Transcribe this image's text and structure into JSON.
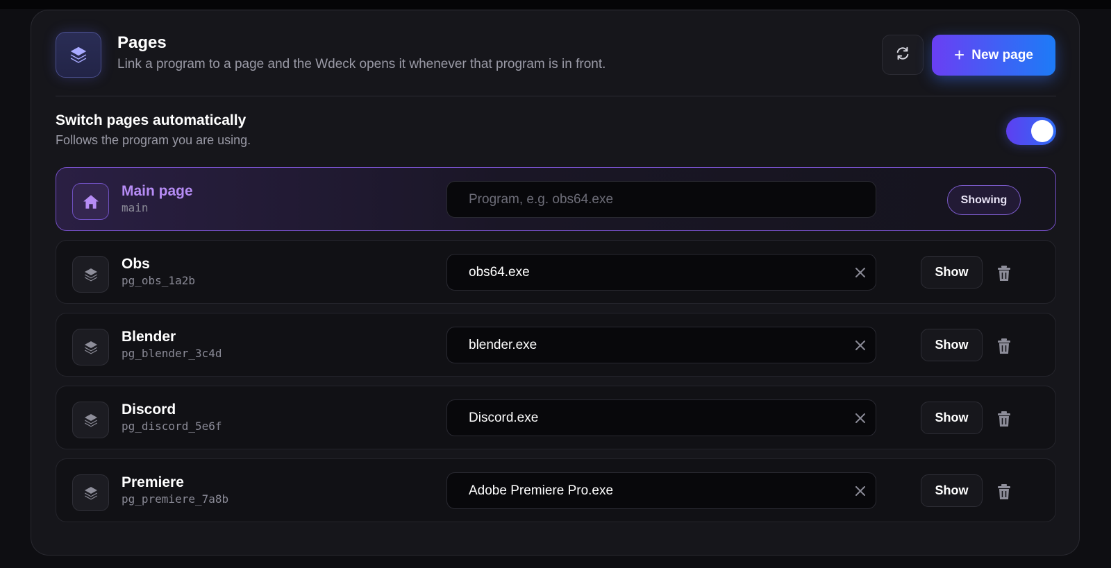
{
  "header": {
    "title": "Pages",
    "subtitle": "Link a program to a page and the Wdeck opens it whenever that program is in front.",
    "icon": "layers-icon",
    "refresh_icon": "refresh-icon",
    "new_button_label": "New page",
    "new_button_icon": "plus-icon"
  },
  "auto_switch": {
    "title": "Switch pages automatically",
    "subtitle": "Follows the program you are using.",
    "enabled": true
  },
  "colors": {
    "accent_purple": "#6a3ff3",
    "accent_blue": "#1d7bf7",
    "active_text": "#b68cf5"
  },
  "pages": [
    {
      "name": "Main page",
      "id": "main",
      "program": "",
      "placeholder": "Program, e.g. obs64.exe",
      "active": true,
      "status": "Showing",
      "icon": "home-icon"
    },
    {
      "name": "Obs",
      "id": "pg_obs_1a2b",
      "program": "obs64.exe",
      "placeholder": "Program, e.g. obs64.exe",
      "active": false,
      "action": "Show",
      "icon": "layers-icon"
    },
    {
      "name": "Blender",
      "id": "pg_blender_3c4d",
      "program": "blender.exe",
      "placeholder": "Program, e.g. obs64.exe",
      "active": false,
      "action": "Show",
      "icon": "layers-icon"
    },
    {
      "name": "Discord",
      "id": "pg_discord_5e6f",
      "program": "Discord.exe",
      "placeholder": "Program, e.g. obs64.exe",
      "active": false,
      "action": "Show",
      "icon": "layers-icon"
    },
    {
      "name": "Premiere",
      "id": "pg_premiere_7a8b",
      "program": "Adobe Premiere Pro.exe",
      "placeholder": "Program, e.g. obs64.exe",
      "active": false,
      "action": "Show",
      "icon": "layers-icon"
    }
  ]
}
